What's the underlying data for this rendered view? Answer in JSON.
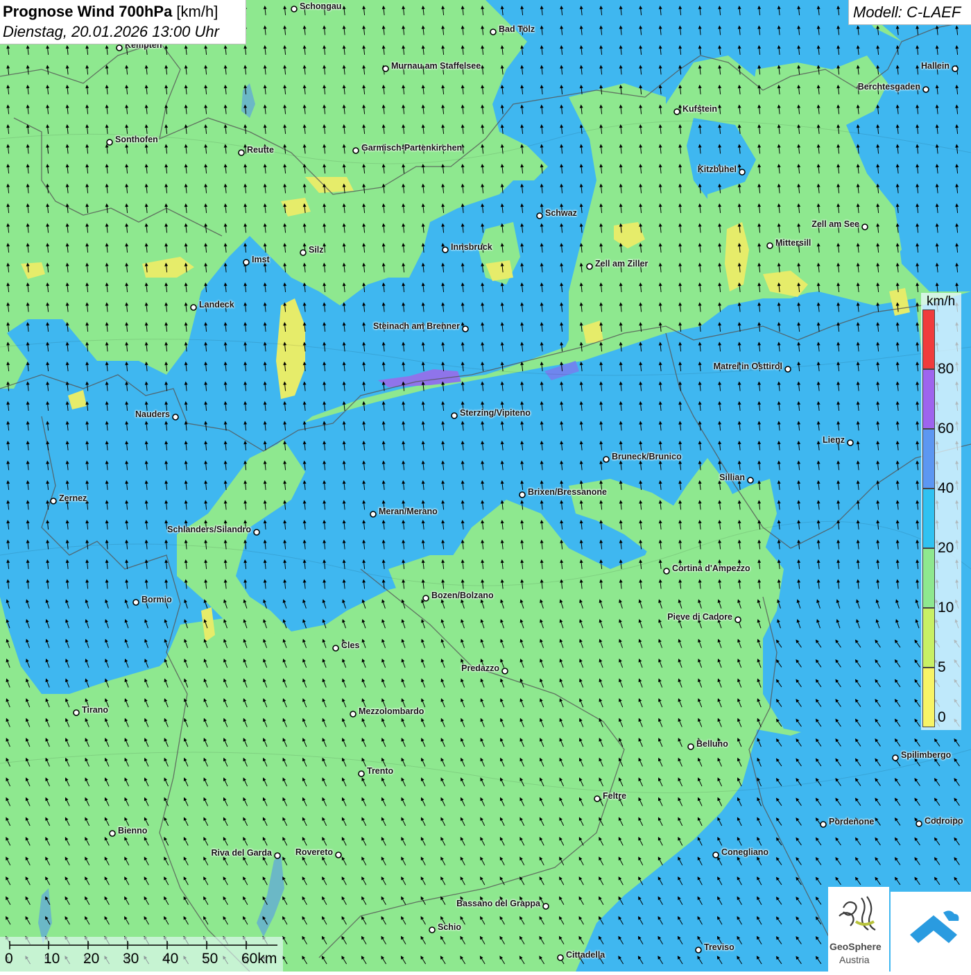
{
  "title": {
    "bold": "Prognose Wind 700hPa",
    "unit": " [km/h]",
    "datetime": "Dienstag, 20.01.2026 13:00 Uhr"
  },
  "model": "Modell: C-LAEF",
  "colors": {
    "land_green": "#8ee88f",
    "wind_blue": "#3fb7f0",
    "wind_mid_blue": "#5aa8f5",
    "wind_yellow": "#e6ec6a",
    "wind_purple": "#9b6ae8"
  },
  "legend": {
    "title": "km/h",
    "items": [
      {
        "label": "80",
        "color": "#f03c3c"
      },
      {
        "label": "60",
        "color": "#9e64ee"
      },
      {
        "label": "40",
        "color": "#5c97f2"
      },
      {
        "label": "20",
        "color": "#30c2f2"
      },
      {
        "label": "10",
        "color": "#8ee88f"
      },
      {
        "label": "5",
        "color": "#c8f064"
      },
      {
        "label": "0",
        "color": "#f7f466"
      }
    ]
  },
  "scale_bar": {
    "labels": [
      "0",
      "10",
      "20",
      "30",
      "40",
      "50",
      "60km"
    ]
  },
  "cities": [
    {
      "name": "Schongau"
    },
    {
      "name": "Bad Tölz"
    },
    {
      "name": "Kempten"
    },
    {
      "name": "Murnau am Staffelsee"
    },
    {
      "name": "Hallein"
    },
    {
      "name": "Berchtesgaden"
    },
    {
      "name": "Kufstein"
    },
    {
      "name": "Sonthofen"
    },
    {
      "name": "Reutte"
    },
    {
      "name": "Garmisch-Partenkirchen"
    },
    {
      "name": "Kitzbühel"
    },
    {
      "name": "Schwaz"
    },
    {
      "name": "Zell am See"
    },
    {
      "name": "Silz"
    },
    {
      "name": "Innsbruck"
    },
    {
      "name": "Mittersill"
    },
    {
      "name": "Imst"
    },
    {
      "name": "Zell am Ziller"
    },
    {
      "name": "Landeck"
    },
    {
      "name": "Steinach am Brenner"
    },
    {
      "name": "Matrei in Osttirol"
    },
    {
      "name": "Nauders"
    },
    {
      "name": "Sterzing/Vipiteno"
    },
    {
      "name": "Lienz"
    },
    {
      "name": "Bruneck/Brunico"
    },
    {
      "name": "Sillian"
    },
    {
      "name": "Zernez"
    },
    {
      "name": "Brixen/Bressanone"
    },
    {
      "name": "Meran/Merano"
    },
    {
      "name": "Schlanders/Silandro"
    },
    {
      "name": "Cortina d'Ampezzo"
    },
    {
      "name": "Bozen/Bolzano"
    },
    {
      "name": "Bormio"
    },
    {
      "name": "Pieve di Cadore"
    },
    {
      "name": "Cles"
    },
    {
      "name": "Predazzo"
    },
    {
      "name": "Tirano"
    },
    {
      "name": "Mezzolombardo"
    },
    {
      "name": "Belluno"
    },
    {
      "name": "Spilimbergo"
    },
    {
      "name": "Trento"
    },
    {
      "name": "Feltre"
    },
    {
      "name": "Pordenone"
    },
    {
      "name": "Codroipo"
    },
    {
      "name": "Bienno"
    },
    {
      "name": "Riva del Garda"
    },
    {
      "name": "Rovereto"
    },
    {
      "name": "Conegliano"
    },
    {
      "name": "Bassano del Grappa"
    },
    {
      "name": "Schio"
    },
    {
      "name": "Treviso"
    },
    {
      "name": "Cittadella"
    }
  ],
  "logos": {
    "geosphere_line1": "GeoSphere",
    "geosphere_line2": "Austria"
  }
}
